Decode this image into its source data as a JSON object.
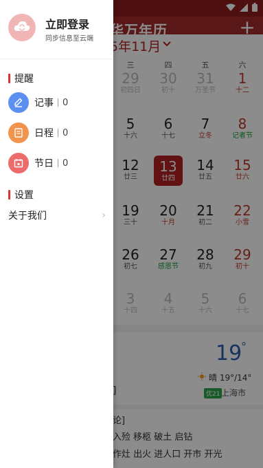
{
  "status_bar": {
    "icons": [
      "wifi-icon",
      "signal-icon",
      "battery-icon"
    ]
  },
  "header": {
    "title": "华万年历",
    "add_icon": "+"
  },
  "month": {
    "label": "5年11月",
    "chevron": "chevron-down-icon"
  },
  "weekdays": [
    "三",
    "四",
    "五",
    "六"
  ],
  "calendar": {
    "rows": [
      [
        {
          "d": "29",
          "s": "初四日",
          "dim": true
        },
        {
          "d": "30",
          "s": "初十",
          "dim": true
        },
        {
          "d": "31",
          "s": "万圣节",
          "dim": true
        },
        {
          "d": "1",
          "s": "十二",
          "red": true
        }
      ],
      [
        {
          "d": "5",
          "s": "十六"
        },
        {
          "d": "6",
          "s": "十七"
        },
        {
          "d": "7",
          "s": "立冬",
          "subc": "red"
        },
        {
          "d": "8",
          "s": "记者节",
          "red": true,
          "subc": "green"
        }
      ],
      [
        {
          "d": "12",
          "s": "廿三"
        },
        {
          "d": "13",
          "s": "廿四",
          "today": true
        },
        {
          "d": "14",
          "s": "廿五"
        },
        {
          "d": "15",
          "s": "廿六",
          "red": true
        }
      ],
      [
        {
          "d": "19",
          "s": "三十"
        },
        {
          "d": "20",
          "s": "十月",
          "subc": "red"
        },
        {
          "d": "21",
          "s": "初二"
        },
        {
          "d": "22",
          "s": "小雪",
          "red": true
        }
      ],
      [
        {
          "d": "26",
          "s": "初七"
        },
        {
          "d": "27",
          "s": "感恩节",
          "subc": "green"
        },
        {
          "d": "28",
          "s": "初九"
        },
        {
          "d": "29",
          "s": "初十",
          "red": true
        }
      ],
      [
        {
          "d": "3",
          "s": "十四",
          "dim": true
        },
        {
          "d": "4",
          "s": "十五",
          "dim": true
        },
        {
          "d": "5",
          "s": "十六",
          "dim": true
        },
        {
          "d": "6",
          "s": "十七",
          "dim": true
        }
      ]
    ]
  },
  "weather": {
    "temp": "19",
    "deg": "°",
    "desc": "晴 19°/14°",
    "aqi": "优21",
    "city": "上海市",
    "bracket": "]"
  },
  "almanac": {
    "title": "论]",
    "yi": "入殓 移柩 破土 启钻",
    "ji": "作灶 出火 进人口 开市 开光"
  },
  "drawer": {
    "login_title": "立即登录",
    "login_sub": "同步信息至云端",
    "reminder_heading": "提醒",
    "items": [
      {
        "label": "记事",
        "count": "0",
        "icon": "pen-icon"
      },
      {
        "label": "日程",
        "count": "0",
        "icon": "list-icon"
      },
      {
        "label": "节日",
        "count": "0",
        "icon": "calendar-icon"
      }
    ],
    "settings_heading": "设置",
    "about_label": "关于我们",
    "about_chevron": "›"
  }
}
